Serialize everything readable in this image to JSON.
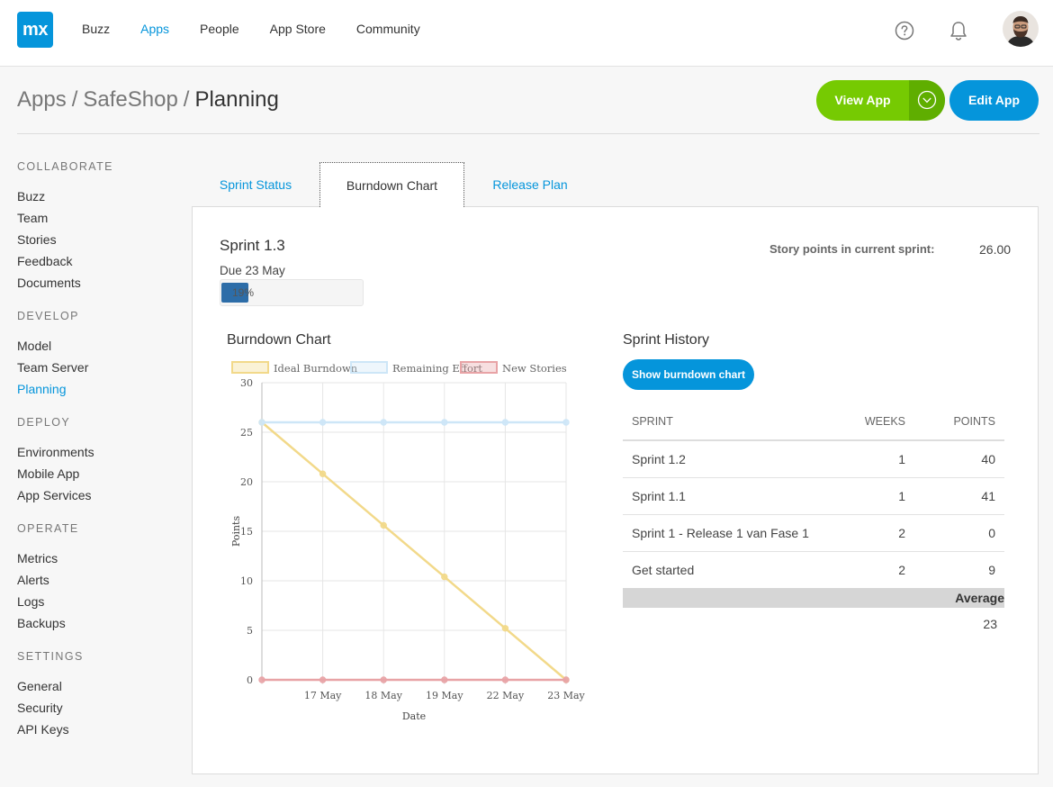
{
  "logo": {
    "text": "mx"
  },
  "nav": {
    "items": [
      "Buzz",
      "Apps",
      "People",
      "App Store",
      "Community"
    ],
    "active": "Apps"
  },
  "icons": {
    "help": "help-circle-icon",
    "notifications": "bell-icon",
    "avatar": "user-avatar"
  },
  "breadcrumb": [
    "Apps",
    "SafeShop",
    "Planning"
  ],
  "actions": {
    "view_app": "View App",
    "edit_app": "Edit App"
  },
  "sidebar": [
    {
      "heading": "COLLABORATE",
      "items": [
        "Buzz",
        "Team",
        "Stories",
        "Feedback",
        "Documents"
      ]
    },
    {
      "heading": "DEVELOP",
      "items": [
        "Model",
        "Team Server",
        "Planning"
      ]
    },
    {
      "heading": "DEPLOY",
      "items": [
        "Environments",
        "Mobile App",
        "App Services"
      ]
    },
    {
      "heading": "OPERATE",
      "items": [
        "Metrics",
        "Alerts",
        "Logs",
        "Backups"
      ]
    },
    {
      "heading": "SETTINGS",
      "items": [
        "General",
        "Security",
        "API Keys"
      ]
    }
  ],
  "sidebar_active": "Planning",
  "tabs": [
    {
      "label": "Sprint Status",
      "active": false
    },
    {
      "label": "Burndown Chart",
      "active": true
    },
    {
      "label": "Release Plan",
      "active": false
    }
  ],
  "sprint": {
    "title": "Sprint 1.3",
    "due": "Due 23 May",
    "progress_label": "19%",
    "progress_percent": 19,
    "story_points_label": "Story points in current sprint:",
    "story_points_value": "26.00"
  },
  "burndown": {
    "heading": "Burndown Chart"
  },
  "chart_data": {
    "type": "line",
    "x": [
      "",
      "17 May",
      "18 May",
      "19 May",
      "22 May",
      "23 May"
    ],
    "xlabel": "Date",
    "ylabel": "Points",
    "ylim": [
      0,
      30
    ],
    "yticks": [
      0,
      5,
      10,
      15,
      20,
      25,
      30
    ],
    "grid": true,
    "legend": "top",
    "series": [
      {
        "name": "Ideal Burndown",
        "values": [
          26,
          20.8,
          15.6,
          10.4,
          5.2,
          0
        ],
        "color": "#f2d98a"
      },
      {
        "name": "Remaining Effort",
        "values": [
          26,
          26,
          26,
          26,
          26,
          26
        ],
        "color": "#cde6f7"
      },
      {
        "name": "New Stories",
        "values": [
          0,
          0,
          0,
          0,
          0,
          0
        ],
        "color": "#e8a3a6"
      }
    ]
  },
  "history": {
    "title": "Sprint History",
    "button": "Show burndown chart",
    "headers": [
      "SPRINT",
      "WEEKS",
      "POINTS"
    ],
    "rows": [
      [
        "Sprint 1.2",
        "1",
        "40"
      ],
      [
        "Sprint 1.1",
        "1",
        "41"
      ],
      [
        "Sprint 1 - Release 1 van Fase 1",
        "2",
        "0"
      ],
      [
        "Get started",
        "2",
        "9"
      ]
    ],
    "average_label": "Average",
    "average_value": "23"
  },
  "colors": {
    "brand": "#0595db",
    "view_app": "#76ca02",
    "progress": "#2d6da8"
  }
}
